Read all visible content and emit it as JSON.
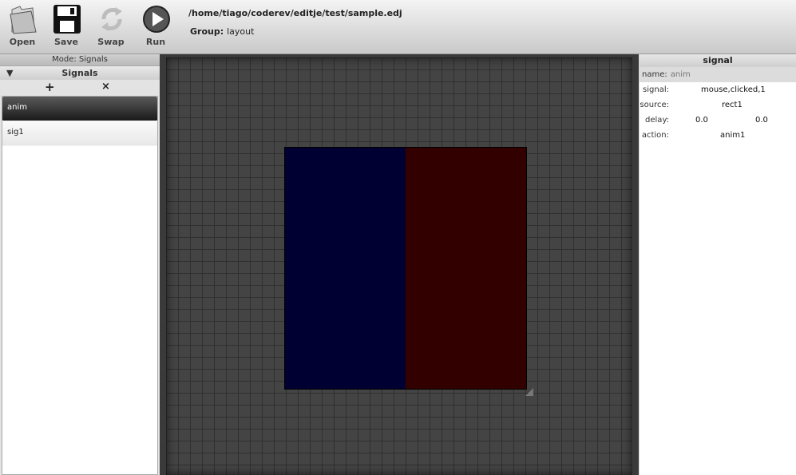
{
  "toolbar": {
    "open_label": "Open",
    "save_label": "Save",
    "swap_label": "Swap",
    "run_label": "Run",
    "file_path": "/home/tiago/coderev/editje/test/sample.edj",
    "group_label": "Group:",
    "group_value": "layout"
  },
  "left_panel": {
    "mode_label": "Mode: Signals",
    "signals_header": "Signals",
    "add_symbol": "+",
    "remove_symbol": "×",
    "signals": [
      {
        "name": "anim",
        "selected": true
      },
      {
        "name": "sig1",
        "selected": false
      }
    ]
  },
  "canvas": {
    "part_colors": {
      "left": "#000033",
      "right": "#330000"
    }
  },
  "right_panel": {
    "title": "signal",
    "name_label": "name:",
    "name_value": "anim",
    "signal_label": "signal:",
    "signal_value": "mouse,clicked,1",
    "source_label": "source:",
    "source_value": "rect1",
    "delay_label": "delay:",
    "delay_value_1": "0.0",
    "delay_value_2": "0.0",
    "action_label": "action:",
    "action_value": "anim1"
  }
}
